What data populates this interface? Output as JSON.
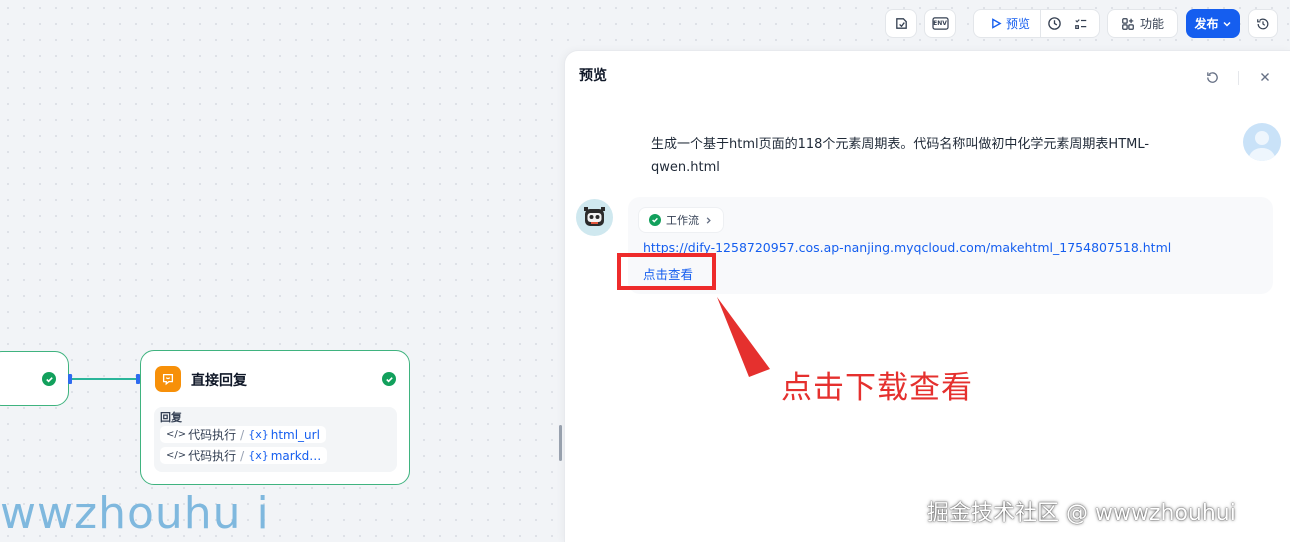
{
  "toolbar": {
    "preview_label": "预览",
    "features_label": "功能",
    "publish_label": "发布",
    "env_label": "ENV"
  },
  "preview_panel": {
    "title": "预览",
    "user_message": "生成一个基于html页面的118个元素周期表。代码名称叫做初中化学元素周期表HTML-qwen.html",
    "workflow_chip": "工作流",
    "link_url": "https://dify-1258720957.cos.ap-nanjing.myqcloud.com/makehtml_1754807518.html",
    "link_text": "点击查看"
  },
  "annotation": {
    "text": "点击下载查看"
  },
  "workflow_node": {
    "title": "直接回复",
    "body_label": "回复",
    "vars": [
      {
        "source": "代码执行",
        "name": "html_url"
      },
      {
        "source": "代码执行",
        "name": "markd…"
      }
    ]
  },
  "watermarks": {
    "left": "wwzhouhu i",
    "right": "掘金技术社区 @ wwwzhouhui"
  },
  "colors": {
    "accent": "#155eef",
    "success": "#12a05c",
    "annotation_red": "#e5302e",
    "node_icon": "#f79009"
  }
}
